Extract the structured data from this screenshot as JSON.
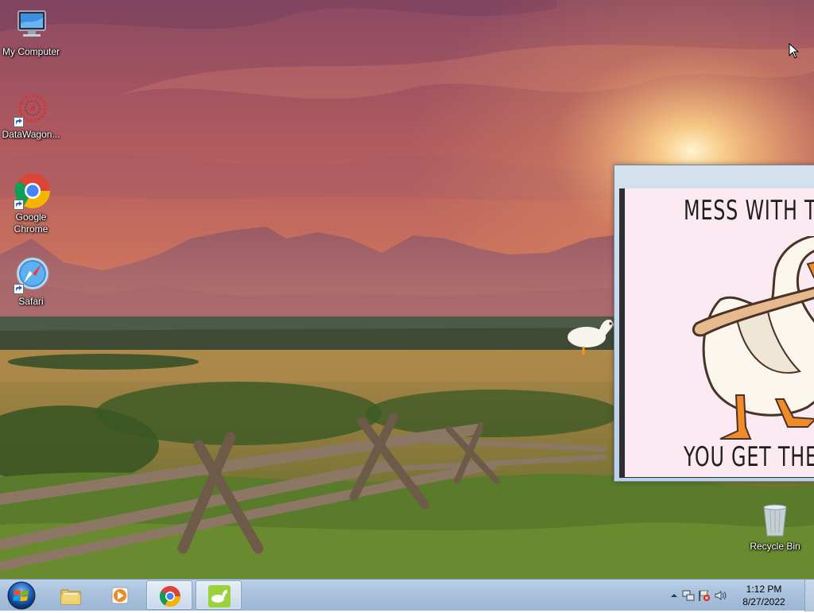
{
  "desktop": {
    "icons": [
      {
        "label": "My Computer",
        "icon": "my-computer-icon"
      },
      {
        "label": "DataWagon...",
        "icon": "datawagon-icon"
      },
      {
        "label": "Google Chrome",
        "icon": "chrome-icon"
      },
      {
        "label": "Safari",
        "icon": "safari-icon"
      },
      {
        "label": "Recycle Bin",
        "icon": "recycle-bin-icon"
      }
    ]
  },
  "goose_window": {
    "meme_top": "MESS WITH THE",
    "meme_bottom": "YOU GET THE"
  },
  "taskbar": {
    "start": "windows-start-icon",
    "pinned": [
      {
        "name": "windows-explorer",
        "icon": "folder-icon",
        "active": false
      },
      {
        "name": "media-player",
        "icon": "media-player-icon",
        "active": false
      },
      {
        "name": "google-chrome",
        "icon": "chrome-icon",
        "active": true
      },
      {
        "name": "goose-app",
        "icon": "goose-icon",
        "active": true
      }
    ],
    "tray": {
      "clock_time": "1:12 PM",
      "clock_date": "8/27/2022",
      "icons": [
        "show-hidden-icons-arrow",
        "network-icon",
        "action-center-flag-icon",
        "volume-icon"
      ]
    }
  },
  "colors": {
    "taskbar": "#a9c1dc",
    "meme_background": "#fbeaf2"
  }
}
